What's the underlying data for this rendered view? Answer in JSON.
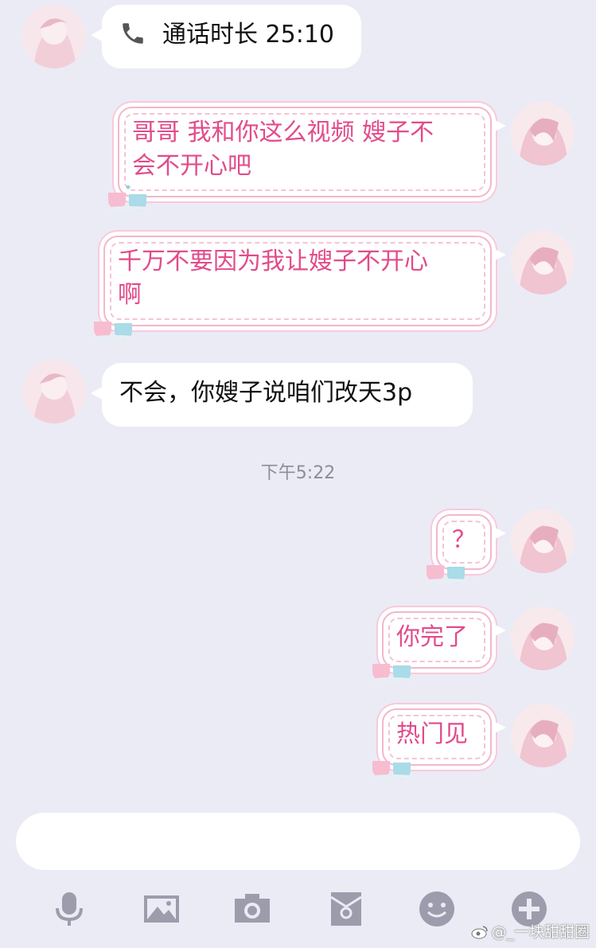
{
  "messages": {
    "call": {
      "label": "通话时长 25:10"
    },
    "m1": {
      "line1": "哥哥 我和你这么视频 嫂子不",
      "line2": "会不开心吧"
    },
    "m2": {
      "line1": "千万不要因为我让嫂子不开心",
      "line2": "啊"
    },
    "m3": {
      "text": "不会，你嫂子说咱们改天3p"
    },
    "time": "下午5:22",
    "m4": {
      "text": "？"
    },
    "m5": {
      "text": "你完了"
    },
    "m6": {
      "text": "热门见"
    }
  },
  "input": {
    "placeholder": ""
  },
  "toolbar": {
    "icons": [
      "microphone-icon",
      "image-icon",
      "camera-icon",
      "wallet-icon",
      "emoji-icon",
      "plus-icon"
    ]
  },
  "watermark": {
    "text": "@_一块甜甜圈"
  },
  "colors": {
    "background": "#ebebf5",
    "bubble_left": "#ffffff",
    "bubble_right_text": "#e24b8a",
    "bubble_right_border": "#f3b6cd",
    "icon": "#9c9cac"
  }
}
